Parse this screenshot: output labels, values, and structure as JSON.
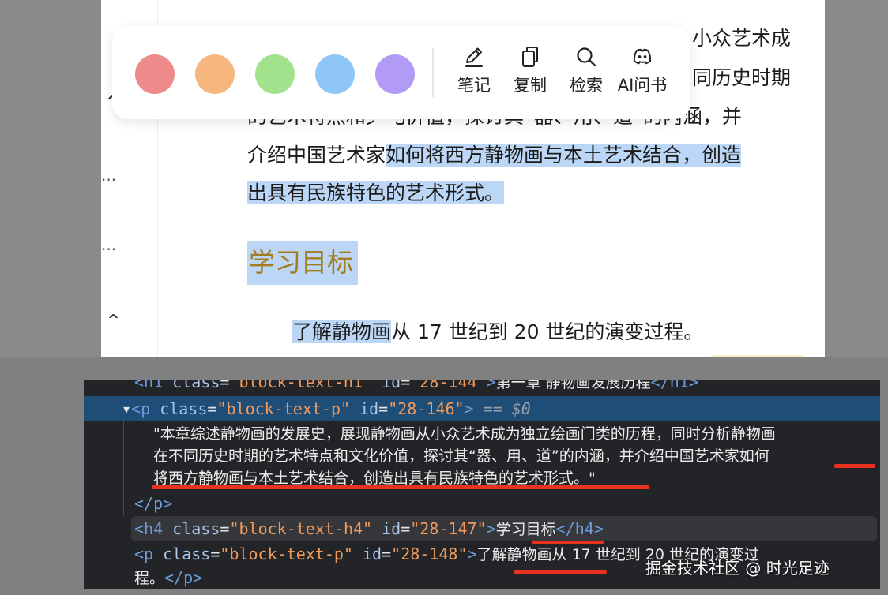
{
  "reader": {
    "lines": [
      "小众艺术成",
      "同历史时期",
      "的艺术特点和文化价值，探讨其“器、用、道”的内涵，并",
      "介绍中国艺术家",
      "如何将西方静物画与本土艺术结合，创造",
      "出具有民族特色的艺术形式。"
    ],
    "heading": "学习目标",
    "item_highlight": "了解静物画",
    "item_rest": "从 17 世纪到 20 世纪的演变过程。",
    "gutter_more": "···",
    "gutter_up": "^"
  },
  "toolbar": {
    "colors": [
      "#ef8a8a",
      "#f5b77e",
      "#a2e28d",
      "#8ec6f8",
      "#b29bf7"
    ],
    "buttons": [
      {
        "label": "笔记",
        "icon": "pencil-icon"
      },
      {
        "label": "复制",
        "icon": "copy-icon"
      },
      {
        "label": "检索",
        "icon": "search-icon"
      },
      {
        "label": "AI问书",
        "icon": "discord-icon"
      }
    ]
  },
  "devtools": {
    "h1_text": "第一章 静物画发展历程",
    "p146": {
      "tag": "p",
      "attr_class": "class",
      "class_val": "\"block-text-p\"",
      "attr_id": "id",
      "id_val": "\"28-146\"",
      "selected": "== $0"
    },
    "p146_text": [
      "\"本章综述静物画的发展史，展现静物画从小众艺术成为独立绘画门类的历程，同时分析静物画",
      "在不同历史时期的艺术特点和文化价值，探讨其“器、用、道”的内涵，并介绍中国艺术家如何",
      "将西方静物画与本土艺术结合，创造出具有民族特色的艺术形式。\""
    ],
    "p_close": "</p>",
    "h4": {
      "tag": "h4",
      "class_val": "\"block-text-h4\"",
      "id_val": "\"28-147\"",
      "text": "学习目标",
      "close": "</h4>"
    },
    "p148": {
      "class_val": "\"block-text-p\"",
      "id_val": "\"28-148\"",
      "text": "了解静物画从 17 世纪到 20 世纪的演变过",
      "text2": "程。",
      "close": "</p>"
    }
  },
  "watermark": "掘金技术社区 @ 时光足迹"
}
